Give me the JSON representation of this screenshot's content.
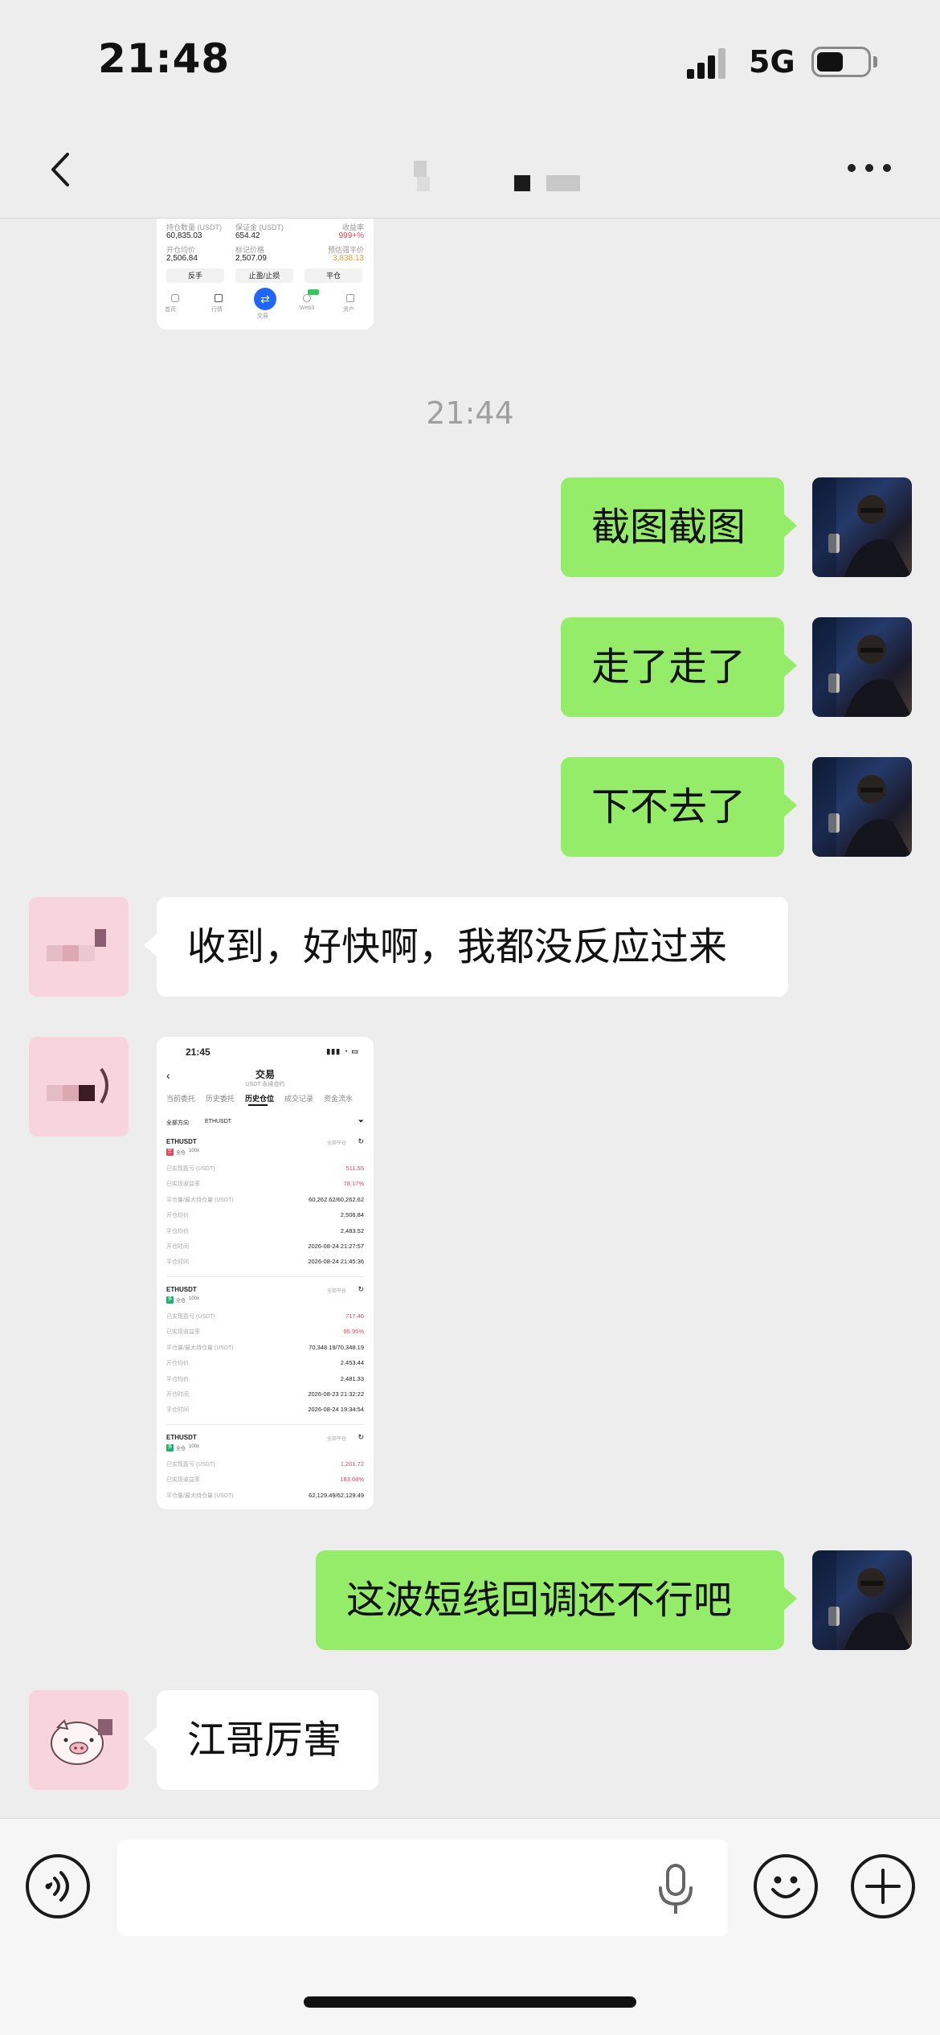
{
  "status_bar": {
    "time": "21:48",
    "network": "5G",
    "battery_level": 0.5
  },
  "nav": {
    "back_icon": "chevron-left-icon",
    "more_icon": "ellipsis-icon"
  },
  "partial_screenshot": {
    "row1_labels": [
      "持仓数量 (USDT)",
      "保证金 (USDT)",
      "收益率"
    ],
    "row1_values": [
      "60,835.03",
      "654.42",
      "999+%"
    ],
    "row2_labels": [
      "开仓均价",
      "标记价格",
      "预估强平价"
    ],
    "row2_values": [
      "2,506.84",
      "2,507.09",
      "3,838.13"
    ],
    "buttons": [
      "反手",
      "止盈/止损",
      "平仓"
    ],
    "tabbar": [
      "首页",
      "行情",
      "交易",
      "Web3",
      "资产"
    ]
  },
  "timestamp": "21:44",
  "messages": [
    {
      "side": "me",
      "text": "截图截图"
    },
    {
      "side": "me",
      "text": "走了走了"
    },
    {
      "side": "me",
      "text": "下不去了"
    },
    {
      "side": "other",
      "text": "收到，好快啊，我都没反应过来"
    },
    {
      "side": "other",
      "type": "image"
    },
    {
      "side": "me",
      "text": "这波短线回调还不行吧"
    },
    {
      "side": "other",
      "text": "江哥厉害"
    }
  ],
  "trade_screenshot": {
    "time": "21:45",
    "title": "交易",
    "subtitle": "USDT 永续合约",
    "tabs": [
      "当前委托",
      "历史委托",
      "历史仓位",
      "成交记录",
      "资金流水"
    ],
    "filters": [
      "全部方向",
      "ETHUSDT"
    ],
    "positions": [
      {
        "symbol": "ETHUSDT",
        "tags": [
          "空",
          "全仓",
          "100x"
        ],
        "action": "全部平仓",
        "rows": [
          [
            "已实现盈亏 (USDT)",
            "511.55"
          ],
          [
            "已实现收益率",
            "78.17%"
          ],
          [
            "平仓量/最大持仓量 (USDT)",
            "60,262.62/60,262.62"
          ],
          [
            "开仓均价",
            "2,506.84"
          ],
          [
            "平仓均价",
            "2,483.52"
          ],
          [
            "开仓时间",
            "2026-08-24 21:27:57"
          ],
          [
            "平仓时间",
            "2026-08-24 21:45:36"
          ]
        ]
      },
      {
        "symbol": "ETHUSDT",
        "tags": [
          "多",
          "全仓",
          "100x"
        ],
        "action": "全部平仓",
        "rows": [
          [
            "已实现盈亏 (USDT)",
            "717.46"
          ],
          [
            "已实现收益率",
            "95.95%"
          ],
          [
            "平仓量/最大持仓量 (USDT)",
            "70,348.19/70,348.19"
          ],
          [
            "开仓均价",
            "2,453.44"
          ],
          [
            "平仓均价",
            "2,481.33"
          ],
          [
            "开仓时间",
            "2026-08-23 21:32:22"
          ],
          [
            "平仓时间",
            "2026-08-24 19:34:54"
          ]
        ]
      },
      {
        "symbol": "ETHUSDT",
        "tags": [
          "多",
          "全仓",
          "100x"
        ],
        "action": "全部平仓",
        "rows": [
          [
            "已实现盈亏 (USDT)",
            "1,201.72"
          ],
          [
            "已实现收益率",
            "183.68%"
          ],
          [
            "平仓量/最大持仓量 (USDT)",
            "62,129.49/62,129.49"
          ]
        ]
      }
    ]
  },
  "input_bar": {
    "voice_icon": "voice-icon",
    "mic_icon": "microphone-icon",
    "emoji_icon": "emoji-icon",
    "plus_icon": "plus-icon"
  },
  "colors": {
    "background": "#ededed",
    "my_bubble": "#95ec69",
    "other_bubble": "#ffffff",
    "profit_red": "#e8445a",
    "accent_blue": "#1f66ff"
  }
}
